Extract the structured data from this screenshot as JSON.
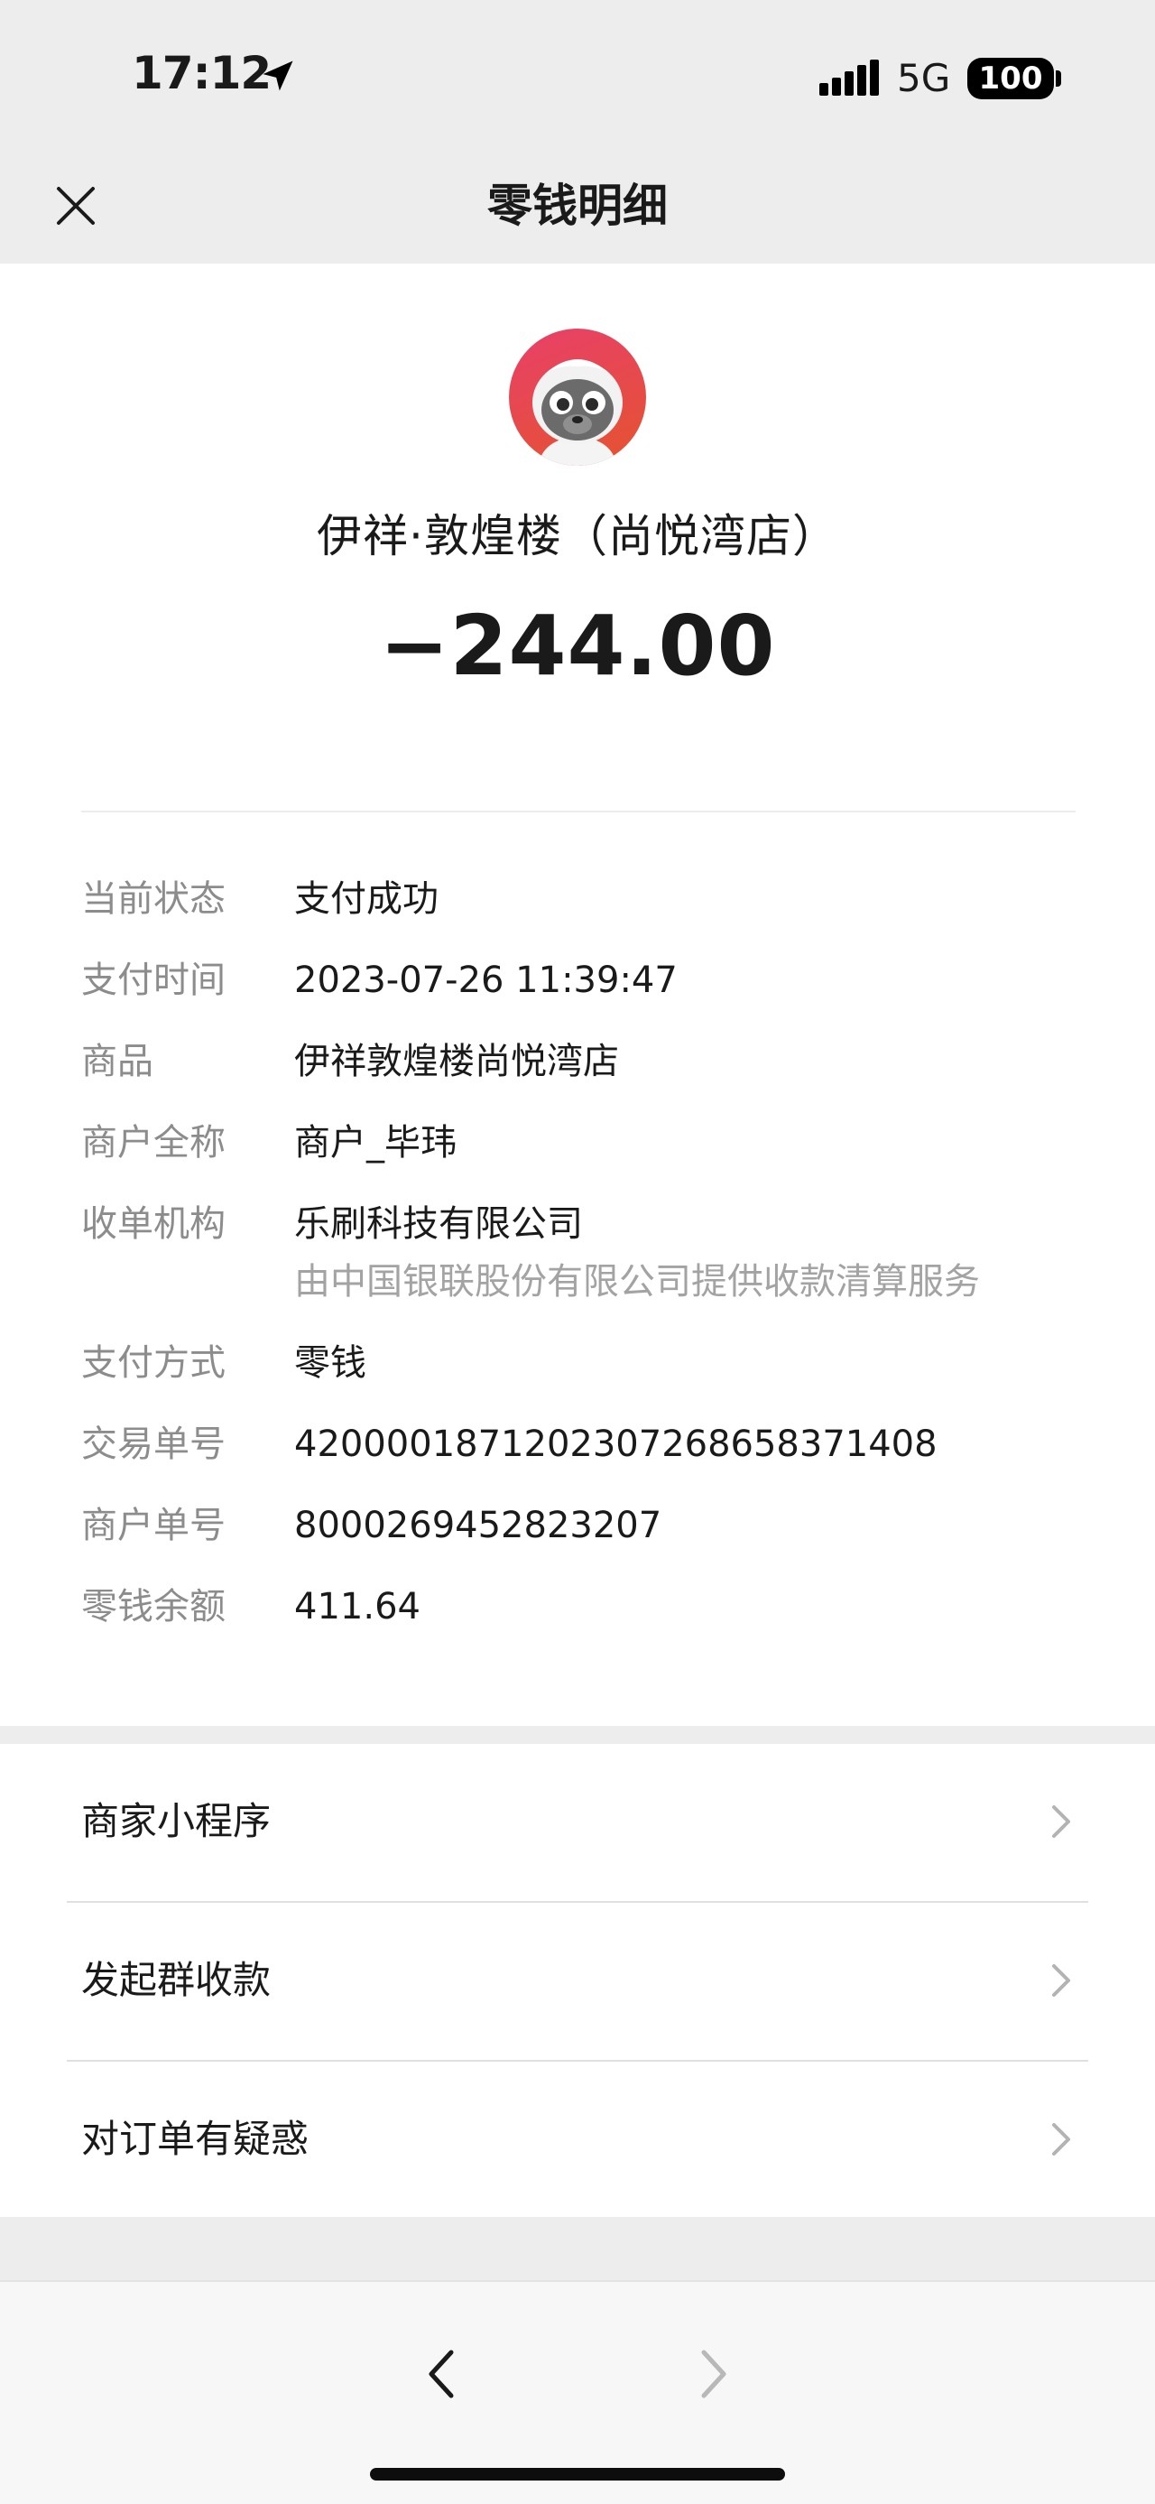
{
  "status_bar": {
    "time": "17:12",
    "network": "5G",
    "battery": "100",
    "icons": [
      "location-arrow-icon",
      "signal-icon"
    ]
  },
  "nav": {
    "title": "零钱明细",
    "close_icon": "close-icon"
  },
  "transaction": {
    "merchant_display_name": "伊祥·敦煌楼（尚悦湾店）",
    "amount": "−244.00",
    "avatar_icon": "merchant-avatar"
  },
  "details": [
    {
      "label": "当前状态",
      "value": "支付成功"
    },
    {
      "label": "支付时间",
      "value": "2023-07-26 11:39:47"
    },
    {
      "label": "商品",
      "value": "伊祥敦煌楼尚悦湾店"
    },
    {
      "label": "商户全称",
      "value": "商户_毕玮"
    },
    {
      "label": "收单机构",
      "value": "乐刷科技有限公司",
      "sub": "由中国银联股份有限公司提供收款清算服务"
    },
    {
      "label": "支付方式",
      "value": "零钱"
    },
    {
      "label": "交易单号",
      "value": "4200001871202307268658371408"
    },
    {
      "label": "商户单号",
      "value": "8000269452823207"
    },
    {
      "label": "零钱余额",
      "value": "411.64"
    }
  ],
  "options": [
    {
      "label": "商家小程序"
    },
    {
      "label": "发起群收款"
    },
    {
      "label": "对订单有疑惑"
    }
  ],
  "toolbar": {
    "back_icon": "chevron-left-icon",
    "forward_icon": "chevron-right-icon"
  },
  "colors": {
    "page_bg": "#ededed",
    "card_bg": "#ffffff",
    "label_gray": "#8c8c8c",
    "sub_gray": "#a3a3a3",
    "avatar_gradient_start": "#e8406a",
    "avatar_gradient_end": "#e5532e"
  }
}
